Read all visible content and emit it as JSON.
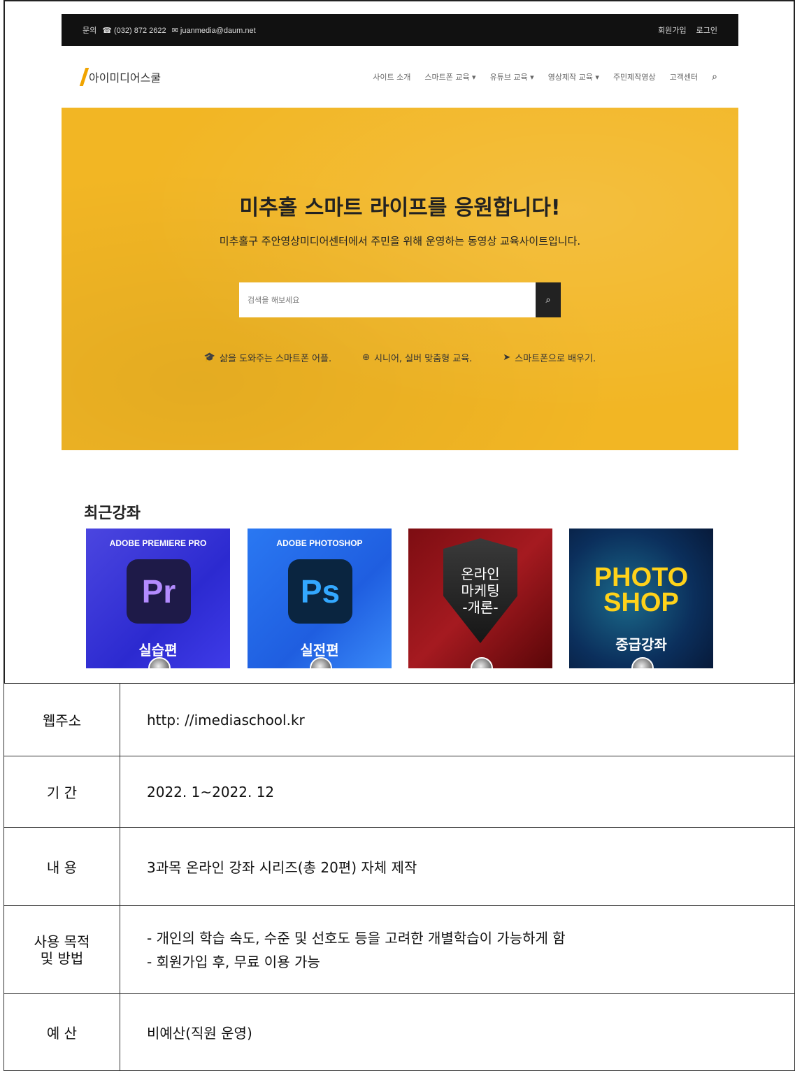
{
  "topbar": {
    "contact_label": "문의",
    "phone": "☎ (032) 872 2622",
    "email": "✉ juanmedia@daum.net",
    "signup": "회원가입",
    "login": "로그인"
  },
  "nav": {
    "logo": "아이미디어스쿨",
    "items": [
      "사이트 소개",
      "스마트폰 교육 ▾",
      "유튜브 교육 ▾",
      "영상제작 교육 ▾",
      "주민제작영상",
      "고객센터"
    ]
  },
  "hero": {
    "title": "미추홀 스마트 라이프를 응원합니다!",
    "subtitle": "미추홀구 주안영상미디어센터에서 주민을 위해 운영하는 동영상 교육사이트입니다.",
    "search_placeholder": "검색을 해보세요",
    "features": [
      "삶을 도와주는 스마트폰 어플.",
      "시니어, 실버 맞춤형 교육.",
      "스마트폰으로 배우기."
    ]
  },
  "recent": {
    "title": "최근강좌",
    "cards": [
      {
        "caption": "ADOBE PREMIERE PRO",
        "tile": "Pr",
        "bottom": "실습편"
      },
      {
        "caption": "ADOBE PHOTOSHOP",
        "tile": "Ps",
        "bottom": "실전편"
      },
      {
        "caption": "",
        "tile": "온라인\n마케팅\n-개론-",
        "bottom": ""
      },
      {
        "caption": "",
        "tile": "PHOTO SHOP",
        "bottom": "중급강좌"
      }
    ]
  },
  "table": {
    "rows": [
      {
        "key": "웹주소",
        "value": "http: //imediaschool.kr"
      },
      {
        "key": "기 간",
        "value": "2022. 1~2022. 12"
      },
      {
        "key": "내 용",
        "value": "3과목 온라인 강좌 시리즈(총 20편) 자체 제작"
      },
      {
        "key": "사용 목적\n및 방법",
        "lines": [
          "- 개인의 학습 속도, 수준 및 선호도 등을 고려한 개별학습이 가능하게 함",
          "- 회원가입 후, 무료 이용 가능"
        ]
      },
      {
        "key": "예 산",
        "value": "비예산(직원 운영)"
      }
    ]
  },
  "colors": {
    "hero_bg": "#f2b624",
    "topbar_bg": "#111111",
    "logo_accent": "#f0a400"
  }
}
